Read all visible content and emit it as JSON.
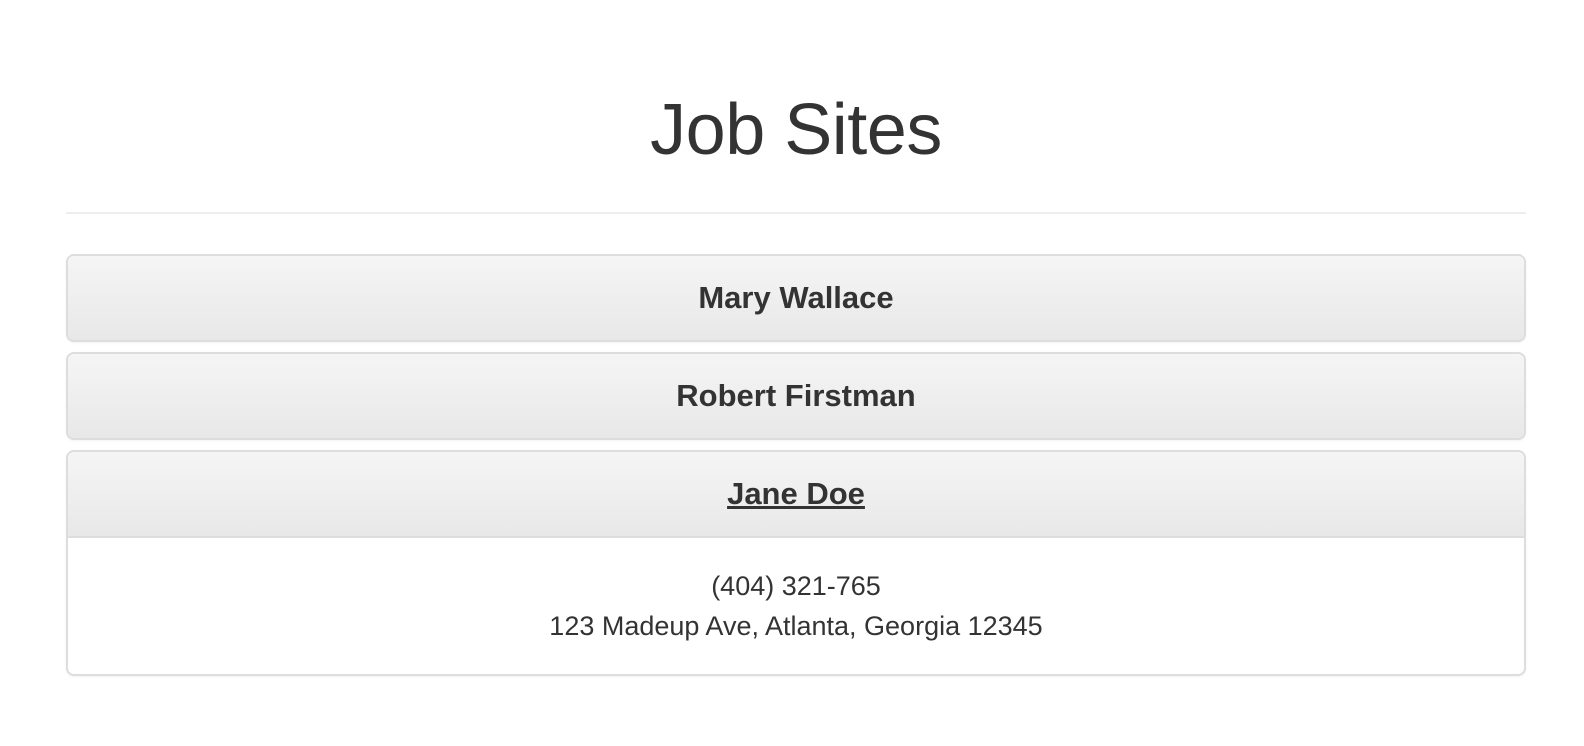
{
  "header": {
    "title": "Job Sites"
  },
  "panels": [
    {
      "name": "Mary Wallace",
      "expanded": false
    },
    {
      "name": "Robert Firstman",
      "expanded": false
    },
    {
      "name": "Jane Doe",
      "expanded": true,
      "phone": "(404) 321-765",
      "address": "123 Madeup Ave, Atlanta, Georgia 12345"
    }
  ],
  "colors": {
    "text": "#333333",
    "border": "#dddddd",
    "heading_bg_top": "#f5f5f5",
    "heading_bg_bottom": "#e8e8e8",
    "divider": "#eeeeee"
  }
}
